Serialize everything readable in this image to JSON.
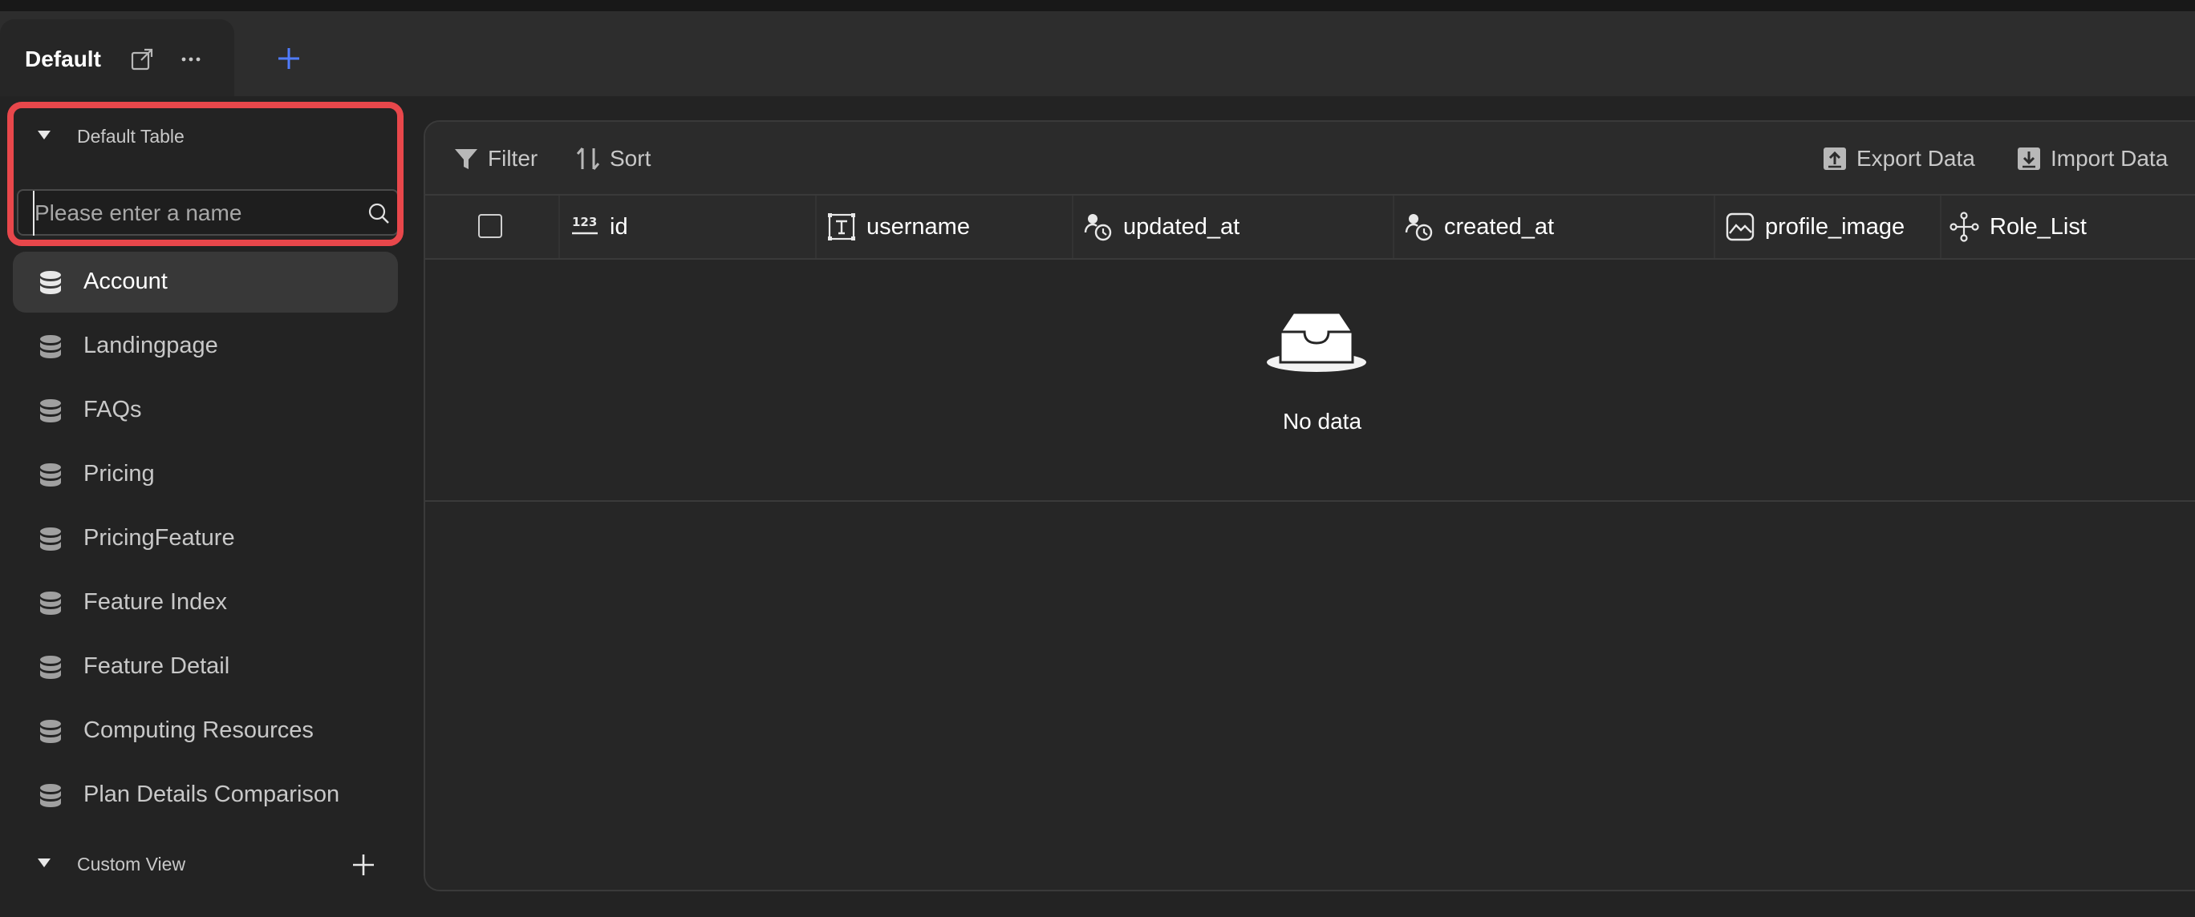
{
  "tab": {
    "title": "Default"
  },
  "sidebar": {
    "section_default": "Default Table",
    "search": {
      "placeholder": "Please enter a name",
      "value": ""
    },
    "items": [
      {
        "label": "Account",
        "active": true
      },
      {
        "label": "Landingpage",
        "active": false
      },
      {
        "label": "FAQs",
        "active": false
      },
      {
        "label": "Pricing",
        "active": false
      },
      {
        "label": "PricingFeature",
        "active": false
      },
      {
        "label": "Feature Index",
        "active": false
      },
      {
        "label": "Feature Detail",
        "active": false
      },
      {
        "label": "Computing Resources",
        "active": false
      },
      {
        "label": "Plan Details Comparison",
        "active": false
      }
    ],
    "section_custom": "Custom View"
  },
  "toolbar": {
    "filter_label": "Filter",
    "sort_label": "Sort",
    "export_label": "Export Data",
    "import_label": "Import Data"
  },
  "table": {
    "columns": [
      {
        "name": "id",
        "icon": "number-icon"
      },
      {
        "name": "username",
        "icon": "text-field-icon"
      },
      {
        "name": "updated_at",
        "icon": "user-clock-icon"
      },
      {
        "name": "created_at",
        "icon": "user-clock-icon"
      },
      {
        "name": "profile_image",
        "icon": "image-icon"
      },
      {
        "name": "Role_List",
        "icon": "relation-icon"
      }
    ],
    "empty_text": "No data"
  },
  "colors": {
    "highlight": "#e8474b",
    "accent": "#4f7cff",
    "background": "#232323"
  }
}
